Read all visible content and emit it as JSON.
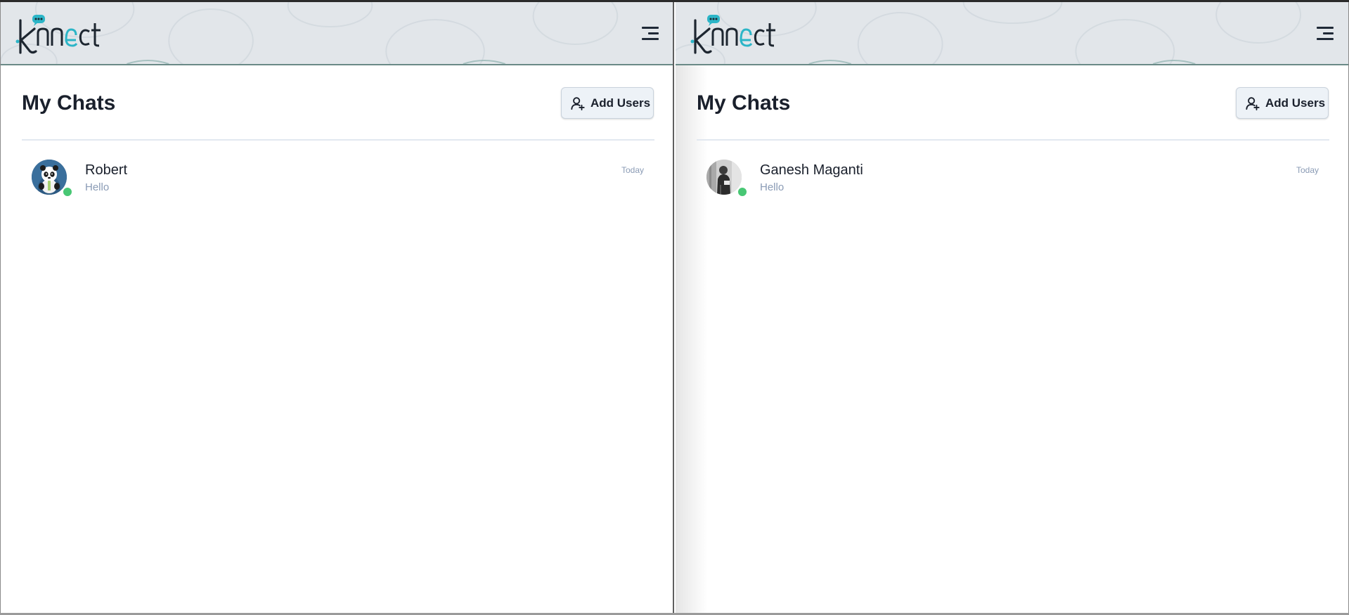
{
  "app": {
    "logo_text": "knnect"
  },
  "colors": {
    "accent": "#2cb5c7",
    "online": "#48c774",
    "header_bg": "#e2e6ea",
    "muted_text": "#8a9bb5"
  },
  "panes": [
    {
      "title": "My Chats",
      "add_users_label": "Add Users",
      "menu_icon": "hamburger-menu-icon",
      "chat": {
        "name": "Robert",
        "last_message": "Hello",
        "time": "Today",
        "avatar": "panda-avatar",
        "online": true
      }
    },
    {
      "title": "My Chats",
      "add_users_label": "Add Users",
      "menu_icon": "hamburger-menu-icon",
      "chat": {
        "name": "Ganesh Maganti",
        "last_message": "Hello",
        "time": "Today",
        "avatar": "person-photo-avatar",
        "online": true
      }
    }
  ]
}
